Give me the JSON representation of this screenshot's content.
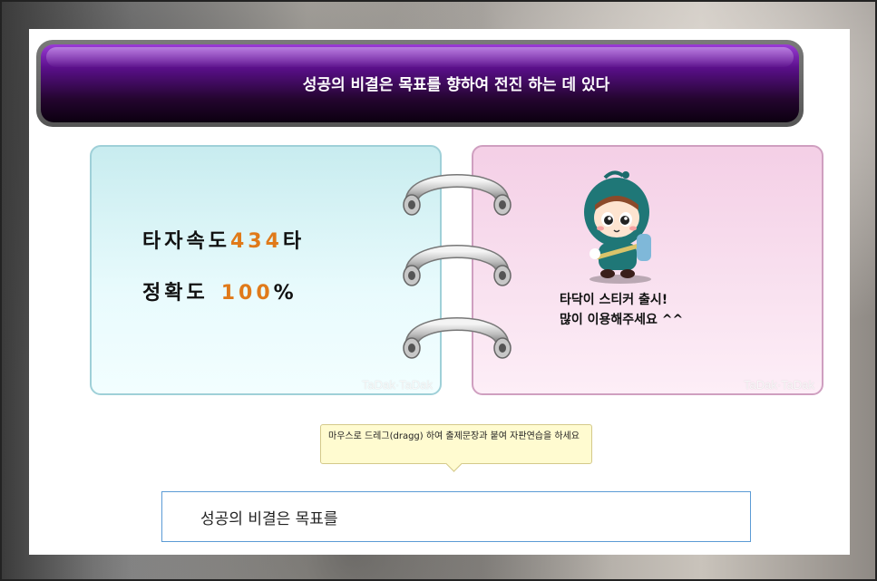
{
  "title": "성공의 비결은 목표를 향하여 전진 하는 데 있다",
  "stats": {
    "speed_label": "타자속도",
    "speed_value": "434",
    "speed_unit": "타",
    "accuracy_label": "정확도",
    "accuracy_value": "100",
    "accuracy_unit": "%"
  },
  "watermark": "TaDak·TaDak",
  "sticker": {
    "line1": "타닥이 스티커 출시!",
    "line2": "많이 이용해주세요 ^^"
  },
  "tooltip": {
    "text": "마우스로 드레그(dragg) 하여 출제문장과 붙여 자판연습을 하세요"
  },
  "typing": {
    "value": "성공의 비결은 목표를"
  },
  "colors": {
    "accent_number": "#e07a1a",
    "title_bg": "#24052f",
    "left_card": "#c8ecef",
    "right_card": "#f4cfe6"
  }
}
